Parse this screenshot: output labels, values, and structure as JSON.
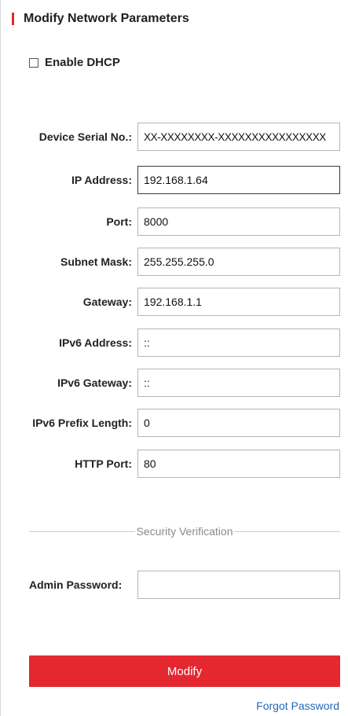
{
  "title": "Modify Network Parameters",
  "accent_color": "#e02b2b",
  "dhcp": {
    "label": "Enable DHCP",
    "checked": false
  },
  "fields": [
    {
      "label": "Device Serial No.:",
      "value": "XX-XXXXXXXX-XXXXXXXXXXXXXXXX"
    },
    {
      "label": "IP Address:",
      "value": "192.168.1.64"
    },
    {
      "label": "Port:",
      "value": "8000"
    },
    {
      "label": "Subnet Mask:",
      "value": "255.255.255.0"
    },
    {
      "label": "Gateway:",
      "value": "192.168.1.1"
    },
    {
      "label": "IPv6 Address:",
      "value": "::"
    },
    {
      "label": "IPv6 Gateway:",
      "value": "::"
    },
    {
      "label": "IPv6 Prefix Length:",
      "value": "0"
    },
    {
      "label": "HTTP Port:",
      "value": "80"
    }
  ],
  "security": {
    "section_label": "Security Verification",
    "password_label": "Admin Password:",
    "password_value": ""
  },
  "actions": {
    "modify_label": "Modify",
    "modify_color": "#e5282f",
    "forgot_label": "Forgot Password",
    "forgot_color": "#2468b3"
  }
}
